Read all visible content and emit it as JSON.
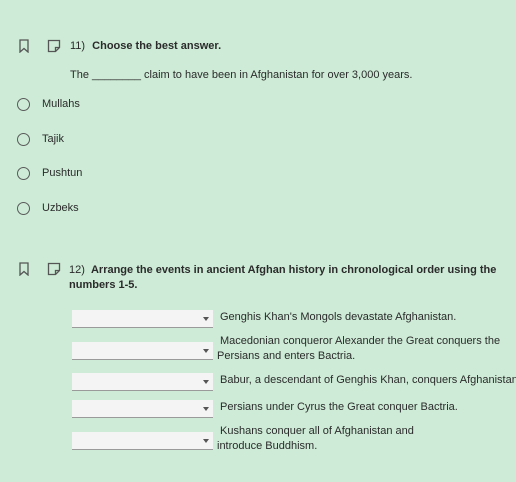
{
  "q11": {
    "number": "11)",
    "prompt": "Choose the best answer.",
    "stem": "The ________ claim to have been in Afghanistan for over 3,000 years.",
    "options": [
      "Mullahs",
      "Tajik",
      "Pushtun",
      "Uzbeks"
    ]
  },
  "q12": {
    "number": "12)",
    "prompt": "Arrange the events in ancient Afghan history in chronological order using the numbers 1-5.",
    "items": [
      "Genghis Khan's Mongols devastate Afghanistan.",
      "Macedonian conqueror Alexander the Great conquers the Persians and enters Bactria.",
      "Babur, a descendant of Genghis Khan, conquers Afghanistan.",
      "Persians under Cyrus the Great conquer Bactria.",
      "Kushans conquer all of Afghanistan and introduce Buddhism."
    ]
  },
  "colors": {
    "background": "#cdebd6",
    "select_bg": "#f4f4f4"
  }
}
